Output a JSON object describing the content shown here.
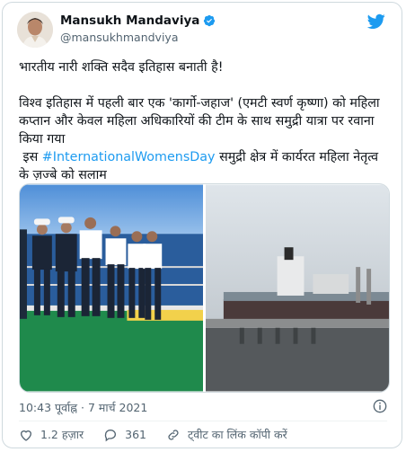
{
  "author": {
    "name": "Mansukh Mandaviya",
    "handle": "@mansukhmandviya"
  },
  "tweet": {
    "line1": "भारतीय नारी शक्ति सदैव इतिहास बनाती है!",
    "para2": "विश्व इतिहास में पहली बार एक 'कार्गो-जहाज' (एमटी स्वर्ण कृष्णा) को महिला कप्तान और केवल महिला अधिकारियों की टीम के साथ समुद्री यात्रा पर रवाना किया गया",
    "para3_prefix": " इस ",
    "hashtag": "#InternationalWomensDay",
    "para3_suffix": " समुद्री क्षेत्र में कार्यरत महिला नेतृत्व के ज़ज्बे को सलाम"
  },
  "timestamp": "10:43 पूर्वाह्न · 7 मार्च 2021",
  "actions": {
    "likes": "1.2 हज़ार",
    "replies": "361",
    "copy_link": "ट्वीट का लिंक कॉपी करें"
  },
  "colors": {
    "brand": "#1d9bf0",
    "text": "#0f1419",
    "secondary": "#536471",
    "like_red": "#f91880"
  },
  "icons": [
    "twitter-bird-icon",
    "verified-badge-icon",
    "info-icon",
    "heart-icon",
    "reply-icon",
    "link-icon"
  ]
}
